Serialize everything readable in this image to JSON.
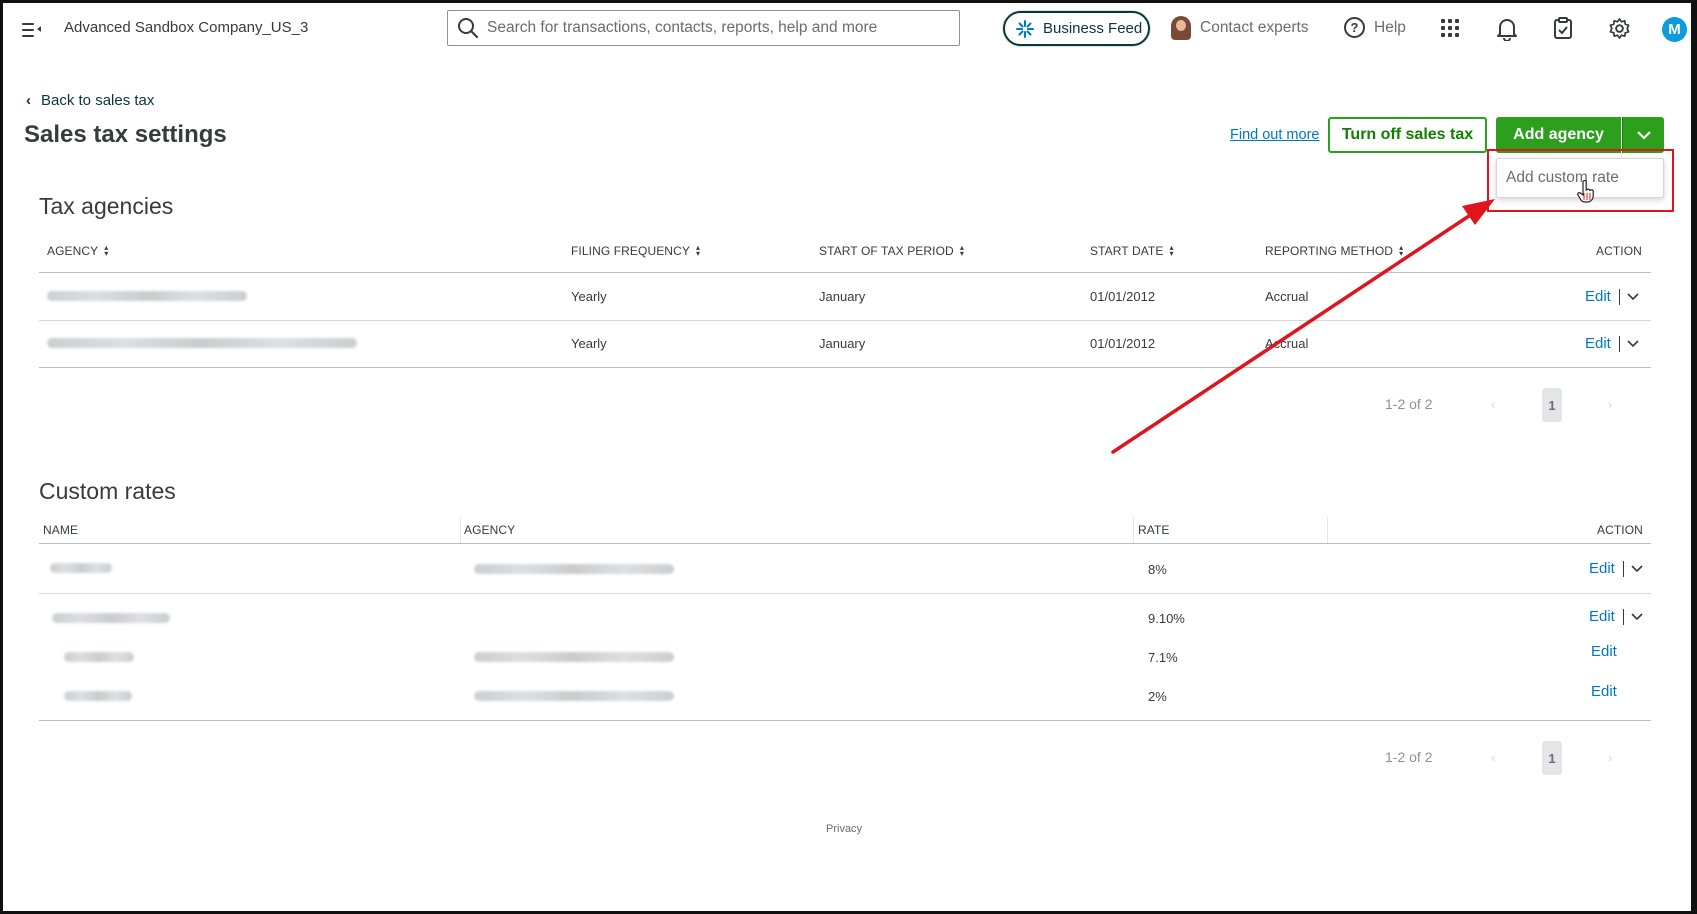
{
  "topbar": {
    "company": "Advanced Sandbox Company_US_3",
    "search_placeholder": "Search for transactions, contacts, reports, help and more",
    "business_feed": "Business Feed",
    "contact_experts": "Contact experts",
    "help": "Help",
    "user_initial": "M",
    "icons": [
      "menu-icon",
      "search-icon",
      "sparkle-icon",
      "apps-grid-icon",
      "bell-icon",
      "clipboard-icon",
      "gear-icon"
    ]
  },
  "header": {
    "back_link": "Back to sales tax",
    "title": "Sales tax settings",
    "find_out_more": "Find out more",
    "turn_off": "Turn off sales tax",
    "add_agency": "Add agency",
    "dropdown_item": "Add custom rate"
  },
  "tax_agencies": {
    "title": "Tax agencies",
    "columns": [
      "AGENCY",
      "FILING FREQUENCY",
      "START OF TAX PERIOD",
      "START DATE",
      "REPORTING METHOD",
      "ACTION"
    ],
    "rows": [
      {
        "frequency": "Yearly",
        "period": "January",
        "start_date": "01/01/2012",
        "method": "Accrual",
        "action": "Edit"
      },
      {
        "frequency": "Yearly",
        "period": "January",
        "start_date": "01/01/2012",
        "method": "Accrual",
        "action": "Edit"
      }
    ],
    "pager": {
      "range": "1-2 of 2",
      "page": "1"
    }
  },
  "custom_rates": {
    "title": "Custom rates",
    "columns": [
      "NAME",
      "AGENCY",
      "RATE",
      "ACTION"
    ],
    "rows": [
      {
        "rate": "8%",
        "action": "Edit"
      },
      {
        "rate": "9.10%",
        "action": "Edit"
      },
      {
        "rate": "7.1%",
        "action": "Edit"
      },
      {
        "rate": "2%",
        "action": "Edit"
      }
    ],
    "pager": {
      "range": "1-2 of 2",
      "page": "1"
    }
  },
  "footer": {
    "privacy": "Privacy"
  },
  "colors": {
    "accent_green": "#2ca01c",
    "link_blue": "#0077c5",
    "annotation_red": "#e0141b"
  }
}
